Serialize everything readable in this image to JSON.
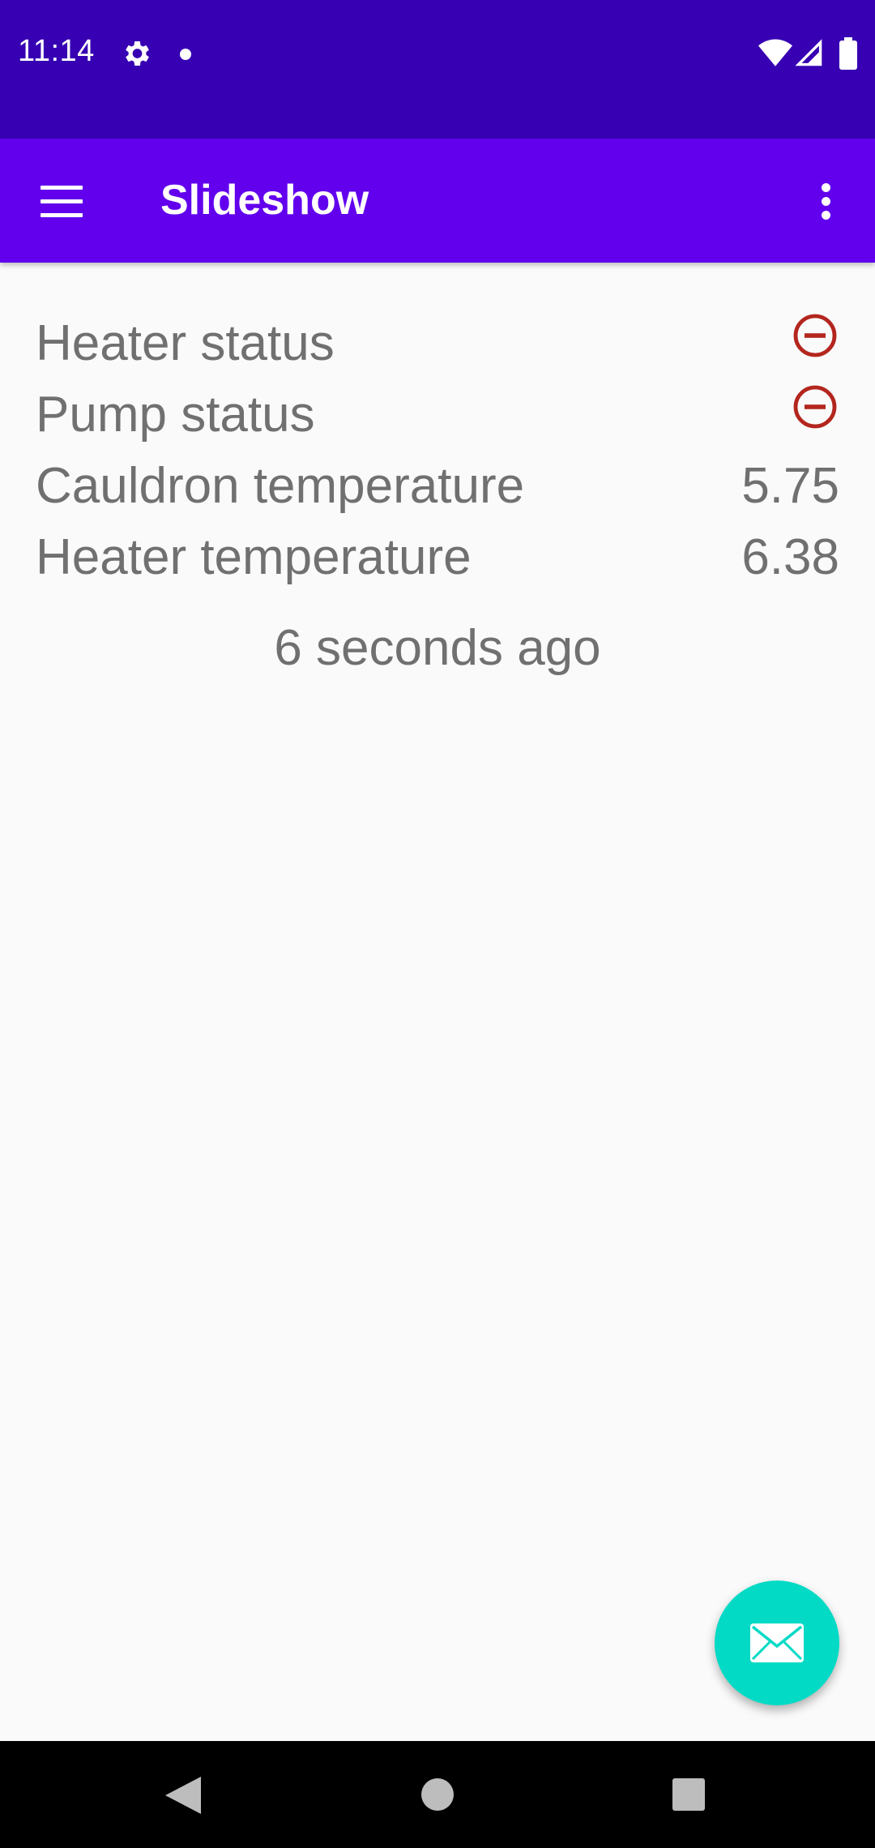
{
  "status_bar": {
    "time": "11:14",
    "icons": [
      "gear-icon",
      "notification-dot-icon",
      "wifi-icon",
      "signal-icon",
      "battery-icon"
    ]
  },
  "app_bar": {
    "title": "Slideshow",
    "menu_icon": "hamburger-menu-icon",
    "overflow_icon": "more-vert-icon",
    "color": "#6200ee"
  },
  "status_rows": [
    {
      "label": "Heater status",
      "icon": "minus-circle-icon"
    },
    {
      "label": "Pump status",
      "icon": "minus-circle-icon"
    },
    {
      "label": "Cauldron temperature",
      "value": "5.75"
    },
    {
      "label": "Heater temperature",
      "value": "6.38"
    }
  ],
  "last_updated": "6 seconds ago",
  "fab": {
    "icon": "email-icon",
    "color": "#03dac5"
  },
  "nav_bar": {
    "icons": [
      "back-icon",
      "home-icon",
      "recents-icon"
    ]
  },
  "colors": {
    "status_bar": "#3700b3",
    "off_status_icon": "#b3261e",
    "text": "#707070"
  }
}
